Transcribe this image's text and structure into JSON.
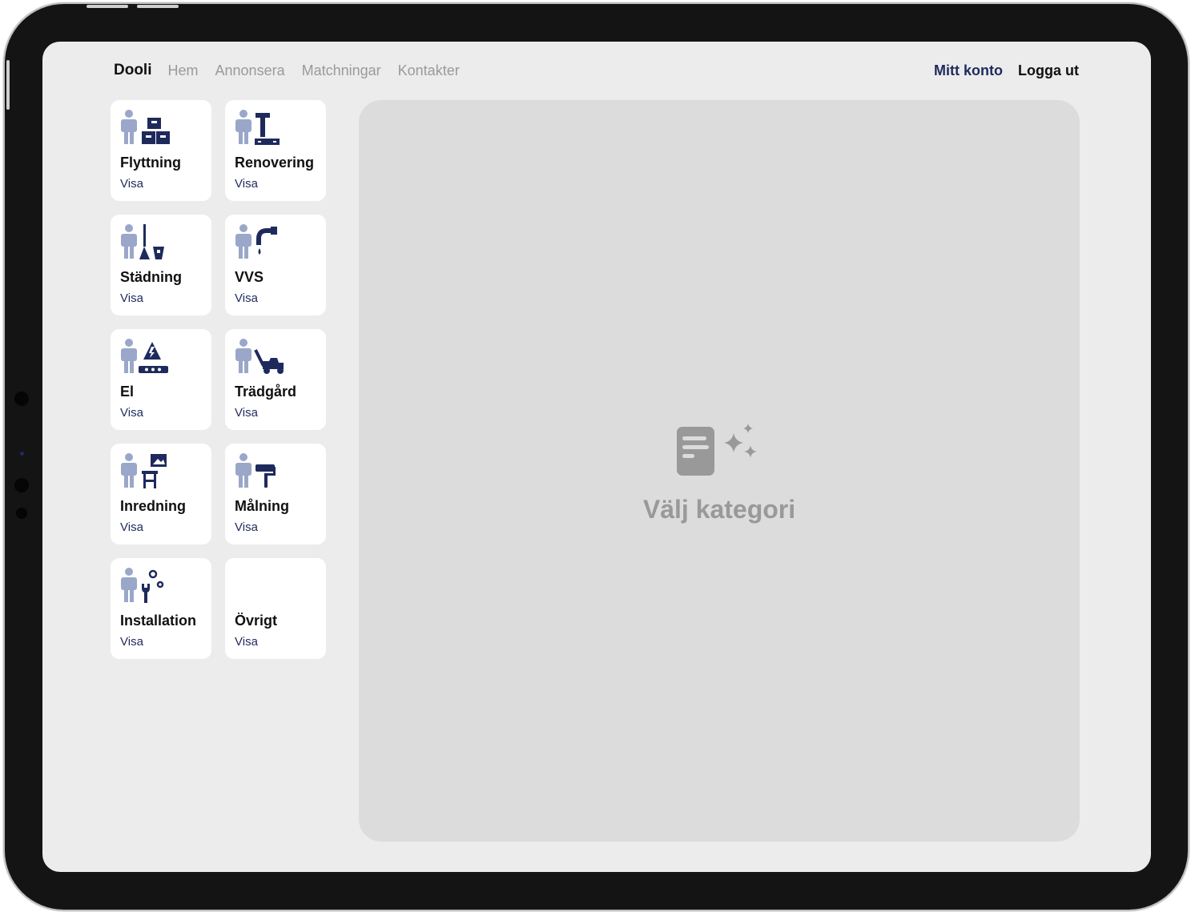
{
  "nav": {
    "brand": "Dooli",
    "links": [
      "Hem",
      "Annonsera",
      "Matchningar",
      "Kontakter"
    ],
    "account": "Mitt konto",
    "logout": "Logga ut"
  },
  "categories": [
    {
      "title": "Flyttning",
      "action": "Visa",
      "icon": "moving-boxes-icon"
    },
    {
      "title": "Renovering",
      "action": "Visa",
      "icon": "hammer-icon"
    },
    {
      "title": "Städning",
      "action": "Visa",
      "icon": "broom-bucket-icon"
    },
    {
      "title": "VVS",
      "action": "Visa",
      "icon": "pipe-leak-icon"
    },
    {
      "title": "El",
      "action": "Visa",
      "icon": "electric-warning-icon"
    },
    {
      "title": "Trädgård",
      "action": "Visa",
      "icon": "lawnmower-icon"
    },
    {
      "title": "Inredning",
      "action": "Visa",
      "icon": "picture-table-icon"
    },
    {
      "title": "Målning",
      "action": "Visa",
      "icon": "paint-roller-icon"
    },
    {
      "title": "Installation",
      "action": "Visa",
      "icon": "wrench-gear-icon"
    },
    {
      "title": "Övrigt",
      "action": "Visa",
      "icon": ""
    }
  ],
  "empty_state": {
    "label": "Välj kategori",
    "icon": "document-sparkle-icon"
  },
  "colors": {
    "accent": "#1f2a5c",
    "person": "#9aa7c9",
    "background": "#ececec",
    "panel": "#dcdcdc"
  }
}
